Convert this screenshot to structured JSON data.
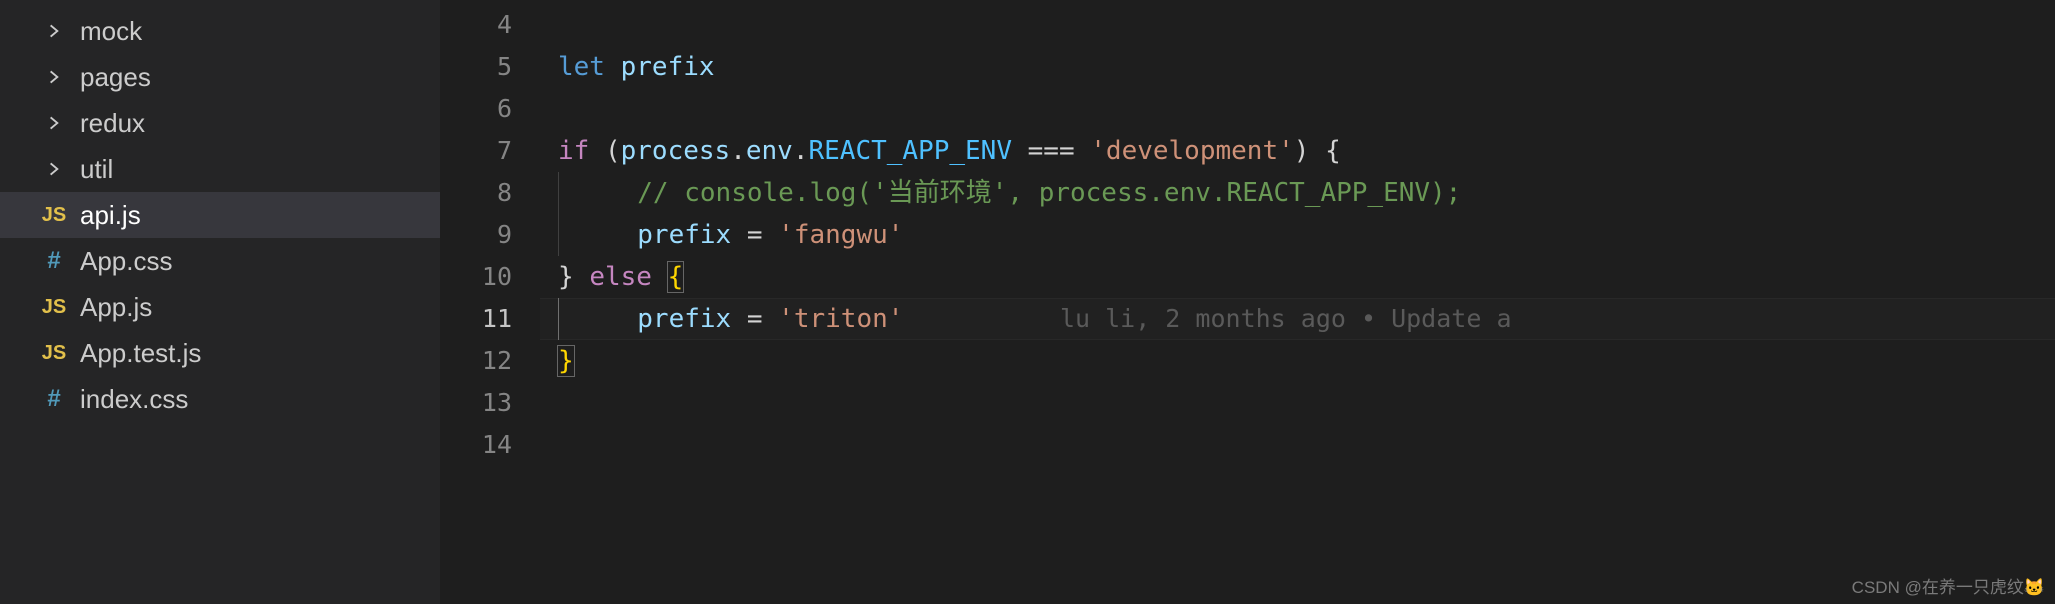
{
  "sidebar": {
    "items": [
      {
        "kind": "folder",
        "label": "mock"
      },
      {
        "kind": "folder",
        "label": "pages"
      },
      {
        "kind": "folder",
        "label": "redux"
      },
      {
        "kind": "folder",
        "label": "util"
      },
      {
        "kind": "js",
        "label": "api.js",
        "selected": true
      },
      {
        "kind": "css",
        "label": "App.css"
      },
      {
        "kind": "js",
        "label": "App.js"
      },
      {
        "kind": "js",
        "label": "App.test.js"
      },
      {
        "kind": "css",
        "label": "index.css"
      }
    ],
    "icon_text": {
      "js": "JS",
      "css": "#"
    }
  },
  "editor": {
    "line_numbers": [
      "4",
      "5",
      "6",
      "7",
      "8",
      "9",
      "10",
      "11",
      "12",
      "13",
      "14"
    ],
    "current_line": "11",
    "code": {
      "l5": {
        "let": "let",
        "sp": " ",
        "prefix": "prefix"
      },
      "l7": {
        "if": "if",
        "sp": " ",
        "op": "(",
        "process": "process",
        "dot1": ".",
        "env": "env",
        "dot2": ".",
        "reactapp": "REACT_APP_ENV",
        "sp2": " ",
        "eq": "===",
        "sp3": " ",
        "str": "'development'",
        "cp": ")",
        "sp4": " ",
        "br": "{"
      },
      "l8": {
        "comment": "// console.log('当前环境', process.env.REACT_APP_ENV);"
      },
      "l9": {
        "prefix": "prefix",
        "sp": " ",
        "eq": "=",
        "sp2": " ",
        "str": "'fangwu'"
      },
      "l10": {
        "cb": "}",
        "sp": " ",
        "else": "else",
        "sp2": " ",
        "ob": "{"
      },
      "l11": {
        "prefix": "prefix",
        "sp": " ",
        "eq": "=",
        "sp2": " ",
        "str": "'triton'",
        "lens": "lu li, 2 months ago • Update a"
      },
      "l12": {
        "cb": "}"
      }
    }
  },
  "watermark": "CSDN @在养一只虎纹🐱"
}
